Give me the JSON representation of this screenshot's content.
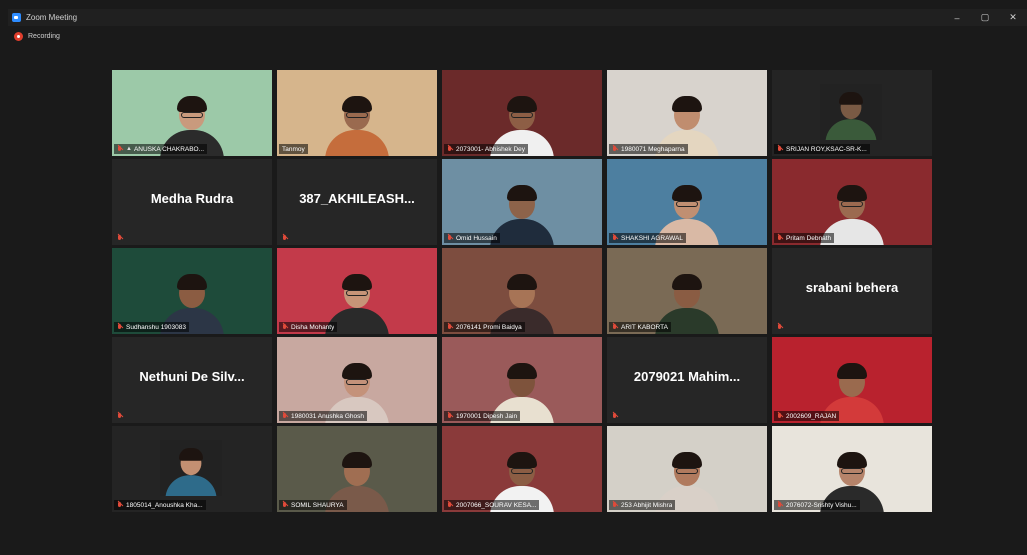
{
  "window": {
    "title": "Zoom Meeting",
    "controls": [
      "–",
      "▢",
      "✕"
    ]
  },
  "recording": {
    "label": "Recording"
  },
  "colors": {
    "active_speaker_border": "#d8e25a",
    "muted_icon": "#e04a3a",
    "app_accent": "#2d8cff",
    "recording": "#e03e2d"
  },
  "tiles": [
    {
      "id": "t1",
      "type": "video",
      "name": "ANUSKA CHAKRABO...",
      "pinned": true,
      "bg": "#9cc9a8",
      "shirt": "#2b2b2b",
      "skin": "#c99a7d",
      "glasses": true
    },
    {
      "id": "t2",
      "type": "video",
      "name": "Tanmoy",
      "active": true,
      "muted": false,
      "bg": "#d6b58c",
      "shirt": "#c56d3c",
      "skin": "#9a6a4f",
      "glasses": true
    },
    {
      "id": "t3",
      "type": "video",
      "name": "2073001- Abhishek Dey",
      "bg": "#6b2a2a",
      "shirt": "#f0f0f0",
      "skin": "#8d5e45",
      "glasses": true
    },
    {
      "id": "t4",
      "type": "video",
      "name": "1980071 Meghaparna",
      "bg": "#d8d3cd",
      "shirt": "#e4d6c0",
      "skin": "#c08d6f",
      "glasses": false
    },
    {
      "id": "t5",
      "type": "video",
      "name": "SRIJAN ROY,KSAC-SR-K...",
      "bg": "#222222",
      "shirt": "#3a5a3a",
      "skin": "#7a5a44",
      "glasses": false,
      "small": true
    },
    {
      "id": "t6",
      "type": "name",
      "name": "",
      "display": "Medha Rudra"
    },
    {
      "id": "t7",
      "type": "name",
      "name": "",
      "display": "387_AKHILEASH..."
    },
    {
      "id": "t8",
      "type": "video",
      "name": "Omid Hussain",
      "bg": "#6e8fa3",
      "shirt": "#1f2c3c",
      "skin": "#8d634a",
      "glasses": false
    },
    {
      "id": "t9",
      "type": "video",
      "name": "SHAKSHI AGRAWAL",
      "bg": "#4d7fa0",
      "shirt": "#d9b9a5",
      "skin": "#c08f72",
      "glasses": true
    },
    {
      "id": "t10",
      "type": "video",
      "name": "Pritam Debnath",
      "bg": "#8a2a2e",
      "shirt": "#e6e6e6",
      "skin": "#9b6a50",
      "glasses": true
    },
    {
      "id": "t11",
      "type": "video",
      "name": "Sudhanshu 1903083",
      "bg": "#1e4b3a",
      "shirt": "#2c3646",
      "skin": "#8b5c42",
      "glasses": false
    },
    {
      "id": "t12",
      "type": "video",
      "name": "Disha Mohanty",
      "bg": "#c33a4a",
      "shirt": "#2a2a2a",
      "skin": "#c69478",
      "glasses": true
    },
    {
      "id": "t13",
      "type": "video",
      "name": "2076141 Promi Baidya",
      "bg": "#7d4d3f",
      "shirt": "#3a2b2b",
      "skin": "#a77456",
      "glasses": false
    },
    {
      "id": "t14",
      "type": "video",
      "name": "ARIT KABORTA",
      "bg": "#7a6a55",
      "shirt": "#2a3a2a",
      "skin": "#8a5c43",
      "glasses": false
    },
    {
      "id": "t15",
      "type": "name",
      "name": "",
      "display": "srabani behera"
    },
    {
      "id": "t16",
      "type": "name",
      "name": "",
      "display": "Nethuni De Silv..."
    },
    {
      "id": "t17",
      "type": "video",
      "name": "1980031 Anushka Ghosh",
      "bg": "#c8a8a0",
      "shirt": "#d8c8c0",
      "skin": "#c4927a",
      "glasses": true
    },
    {
      "id": "t18",
      "type": "video",
      "name": "1970001 Dipesh Jain",
      "bg": "#9a5a5a",
      "shirt": "#e8e0d0",
      "skin": "#7e533c",
      "glasses": false
    },
    {
      "id": "t19",
      "type": "name",
      "name": "",
      "display": "2079021 Mahim..."
    },
    {
      "id": "t20",
      "type": "video",
      "name": "2002609_RAJAN",
      "bg": "#b9222e",
      "shirt": "#d33a3a",
      "skin": "#9a6a4e",
      "glasses": false
    },
    {
      "id": "t21",
      "type": "video",
      "name": "1805014_Anoushka Kha...",
      "bg": "#222222",
      "shirt": "#2e6b8a",
      "skin": "#c39072",
      "glasses": false,
      "small": true
    },
    {
      "id": "t22",
      "type": "video",
      "name": "SOMIL SHAURYA",
      "bg": "#5a5a4a",
      "shirt": "#7a5a4a",
      "skin": "#a06e52",
      "glasses": false
    },
    {
      "id": "t23",
      "type": "video",
      "name": "2007066_SOURAV KESA...",
      "bg": "#8a3a3a",
      "shirt": "#f2f2f2",
      "skin": "#8b5d44",
      "glasses": true
    },
    {
      "id": "t24",
      "type": "video",
      "name": "253 Abhijit Mishra",
      "bg": "#d4d0c8",
      "shirt": "#d9d0c8",
      "skin": "#b07a5e",
      "glasses": true
    },
    {
      "id": "t25",
      "type": "video",
      "name": "2076072-Srishty Vishu...",
      "bg": "#e8e4dc",
      "shirt": "#2a2a2a",
      "skin": "#b5836a",
      "glasses": true
    }
  ]
}
